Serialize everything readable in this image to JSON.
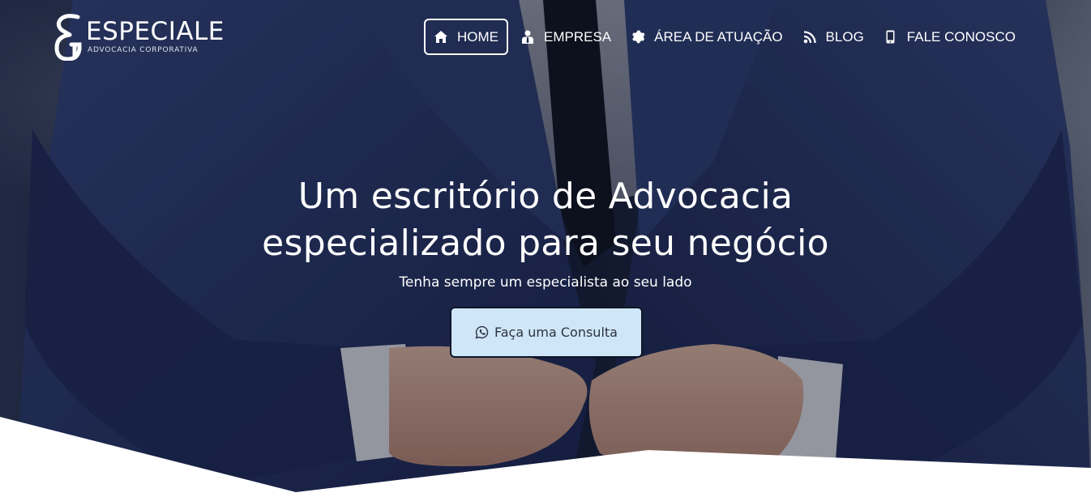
{
  "brand": {
    "name": "ESPECIALE",
    "tagline": "ADVOCACIA CORPORATIVA",
    "logo_icon": "eg-monogram-icon"
  },
  "nav": {
    "items": [
      {
        "label": "HOME",
        "icon": "home-icon",
        "active": true
      },
      {
        "label": "EMPRESA",
        "icon": "user-tie-icon",
        "active": false
      },
      {
        "label": "ÁREA DE ATUAÇÃO",
        "icon": "gear-icon",
        "active": false
      },
      {
        "label": "BLOG",
        "icon": "rss-icon",
        "active": false
      },
      {
        "label": "FALE CONOSCO",
        "icon": "mobile-phone-icon",
        "active": false
      }
    ]
  },
  "hero": {
    "headline_line1": "Um escritório de Advocacia",
    "headline_line2": "especializado para seu negócio",
    "subheadline": "Tenha sempre um especialista ao seu lado",
    "cta_label": "Faça uma Consulta",
    "cta_icon": "whatsapp-icon"
  },
  "colors": {
    "cta_background": "#cfe6f8",
    "cta_border": "#0d1526",
    "text_on_hero": "#ffffff",
    "jacket": "#26345e"
  }
}
